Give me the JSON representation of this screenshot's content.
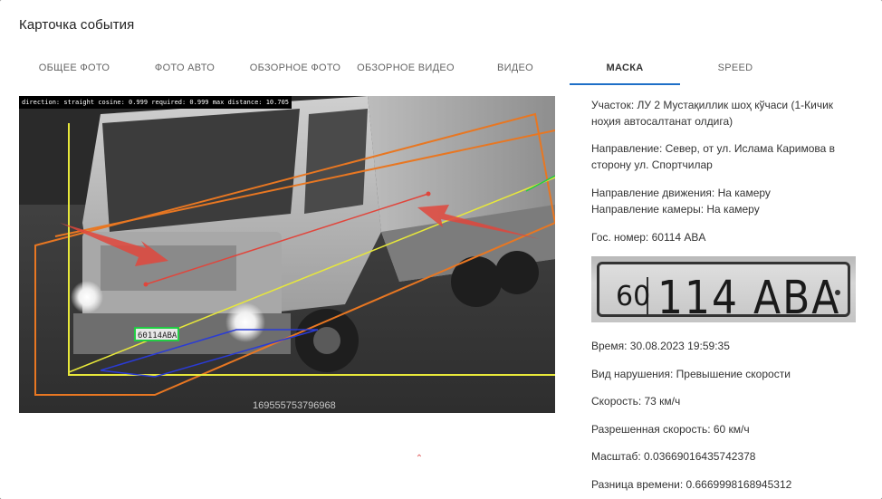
{
  "modal": {
    "title": "Карточка события"
  },
  "tabs": [
    {
      "label": "ОБЩЕЕ ФОТО",
      "active": false
    },
    {
      "label": "ФОТО АВТО",
      "active": false
    },
    {
      "label": "ОБЗОРНОЕ ФОТО",
      "active": false
    },
    {
      "label": "ОБЗОРНОЕ ВИДЕО",
      "active": false
    },
    {
      "label": "ВИДЕО",
      "active": false
    },
    {
      "label": "МАСКА",
      "active": true
    },
    {
      "label": "SPEED",
      "active": false
    }
  ],
  "image": {
    "overlay_text": "direction: straight   cosine: 0.999   required: 0.999   max distance: 10.705",
    "frame_id": "169555753796968",
    "plate_tag": "60114ABA"
  },
  "info": {
    "section": "Участок: ЛУ 2 Мустақиллик шоҳ кўчаси (1-Кичик ноҳия автосалтанат олдига)",
    "direction": "Направление: Север, от ул. Ислама Каримова в сторону ул. Спортчилар",
    "movement_direction": "Направление движения: На камеру",
    "camera_direction": "Направление камеры: На камеру",
    "plate_number": "Гос. номер: 60114 ABA",
    "plate_image": {
      "region": "60",
      "number": "114 ABA"
    },
    "time": "Время: 30.08.2023 19:59:35",
    "violation": "Вид нарушения: Превышение скорости",
    "speed": "Скорость: 73 км/ч",
    "allowed_speed": "Разрешенная скорость: 60 км/ч",
    "scale": "Масштаб: 0.03669016435742378",
    "time_diff": "Разница времени: 0.6669998168945312"
  },
  "colors": {
    "accent": "#1e6fc7",
    "orange_zone": "#e87722",
    "yellow_zone": "#e8e83a",
    "red_arrow": "#e0463c",
    "blue_line": "#2a3bd6",
    "green_box": "#22cc44"
  },
  "icons": {
    "scroll_up": "chevron-up-icon"
  }
}
